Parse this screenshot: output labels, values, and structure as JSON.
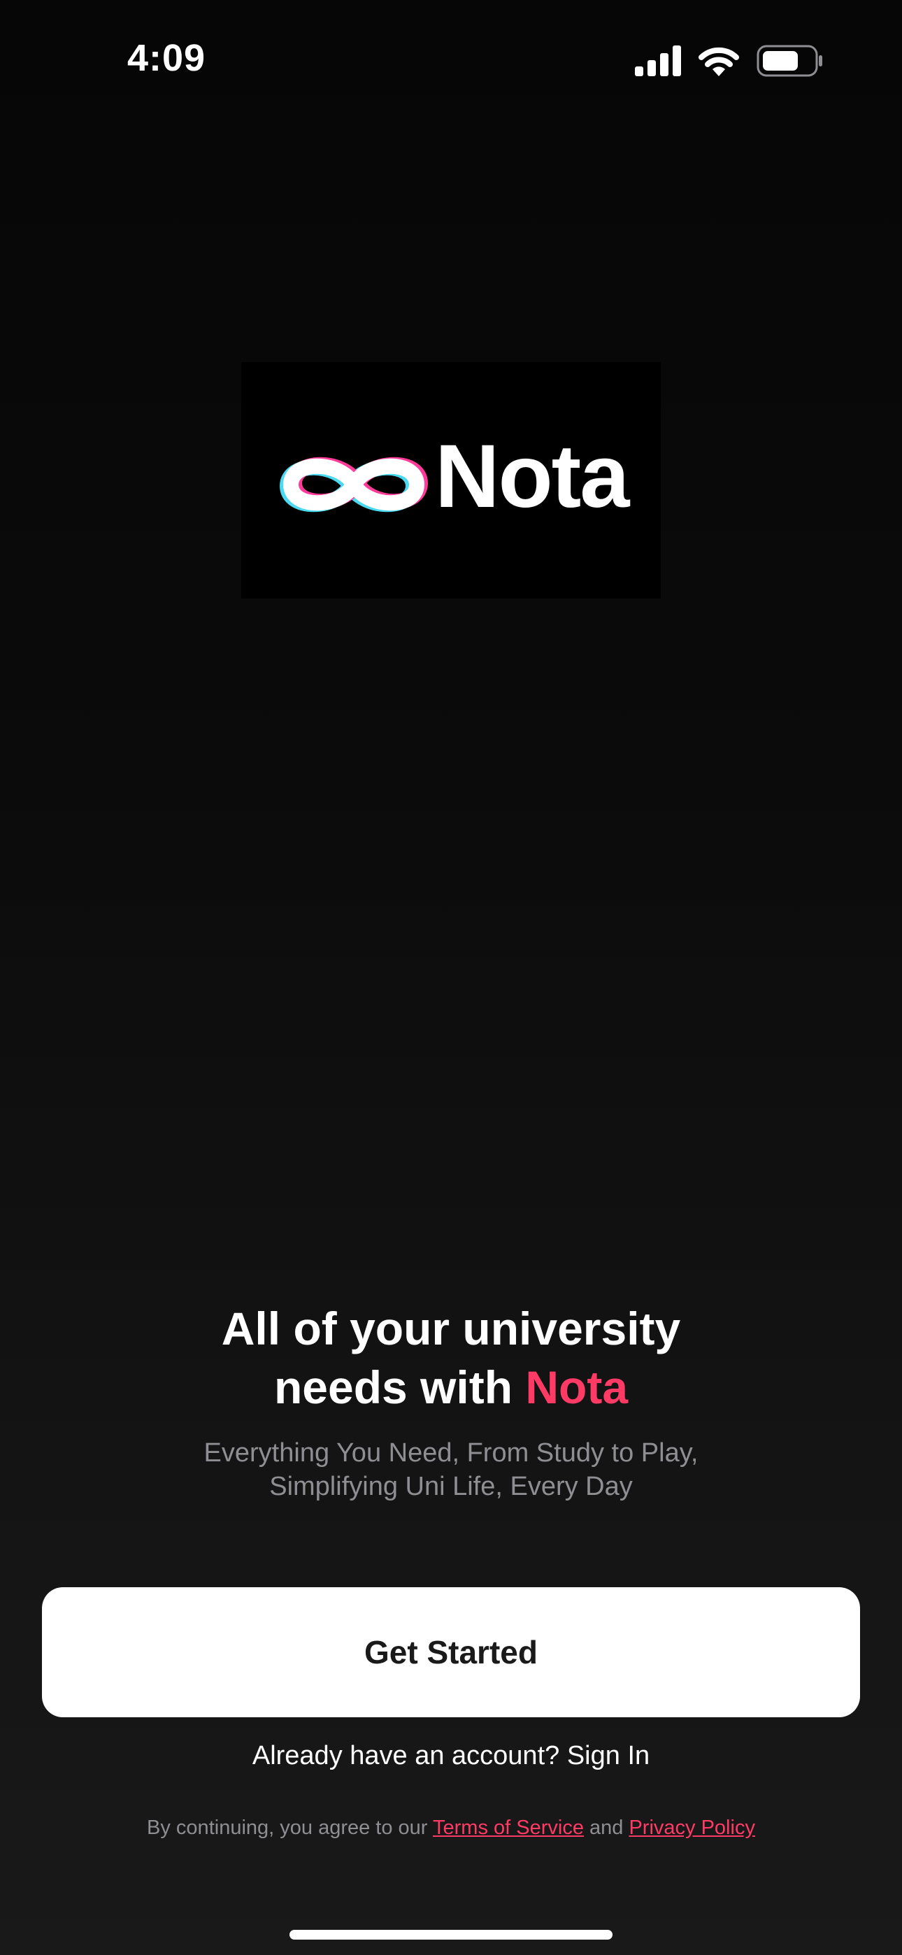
{
  "status_bar": {
    "time": "4:09",
    "icons": [
      "cellular-signal-icon",
      "wifi-icon",
      "battery-icon"
    ]
  },
  "logo": {
    "icon": "infinity-icon",
    "wordmark": "Nota"
  },
  "headline": {
    "line1": "All of your university",
    "line2_prefix": "needs with ",
    "line2_accent": "Nota"
  },
  "subtitle": {
    "line1": "Everything You Need, From Study to Play,",
    "line2": "Simplifying Uni Life, Every Day"
  },
  "primary_button": {
    "label": "Get Started"
  },
  "signin": {
    "prompt": "Already have an account? ",
    "link": "Sign In"
  },
  "legal": {
    "prefix": "By continuing, you agree to our ",
    "terms": "Terms of Service",
    "conjunction": " and ",
    "privacy": "Privacy Policy"
  },
  "colors": {
    "background": "#0d0d0d",
    "accent": "#ff3b65",
    "button_bg": "#ffffff",
    "muted_text": "#8e8e93"
  }
}
